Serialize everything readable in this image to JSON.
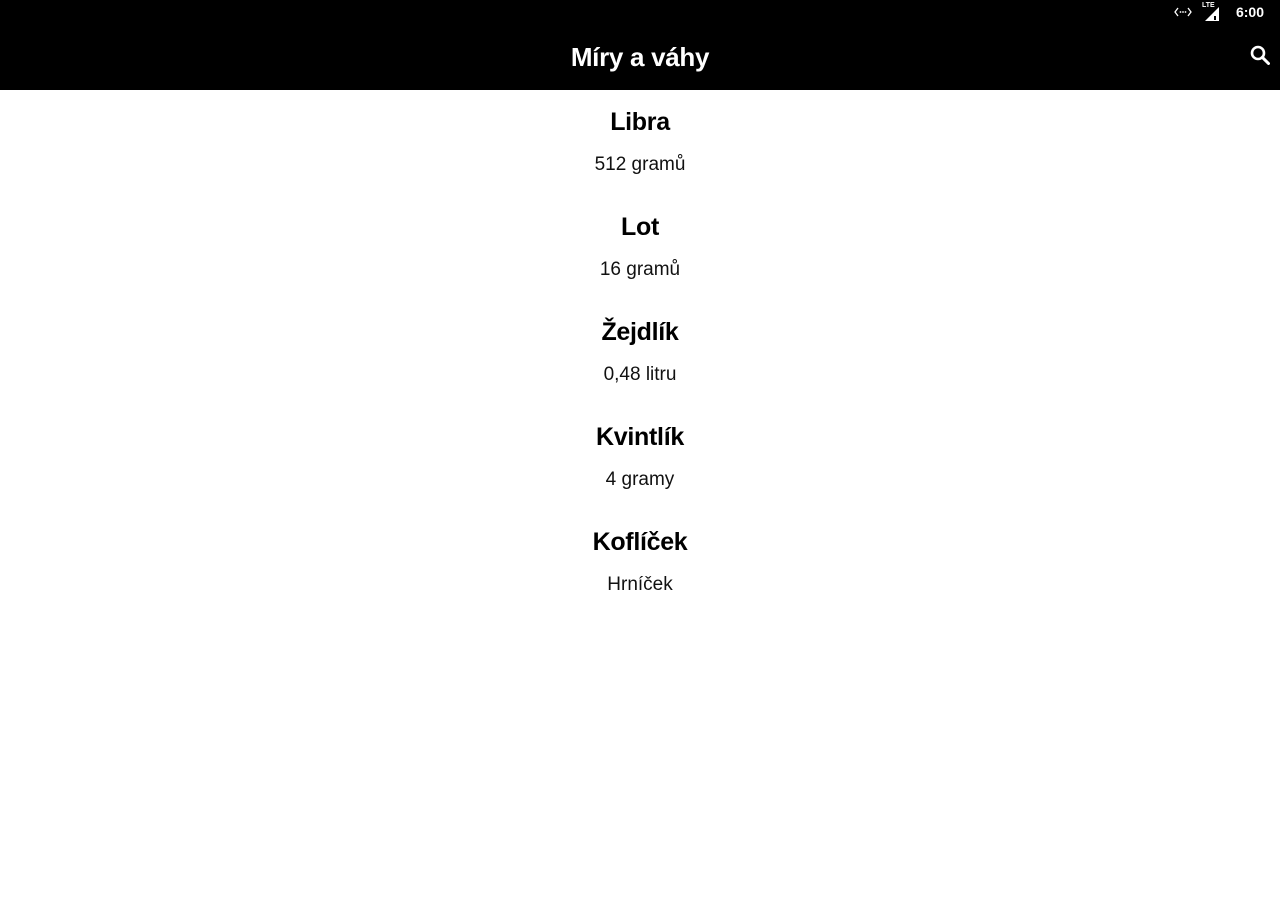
{
  "status_bar": {
    "time": "6:00",
    "network_label": "LTE",
    "icons": [
      "data-activity-icon",
      "lte-signal-icon"
    ]
  },
  "app_bar": {
    "title": "Míry a váhy",
    "search_icon": "search-icon"
  },
  "items": [
    {
      "title": "Libra",
      "value": "512 gramů"
    },
    {
      "title": "Lot",
      "value": "16 gramů"
    },
    {
      "title": "Žejdlík",
      "value": "0,48 litru"
    },
    {
      "title": "Kvintlík",
      "value": "4 gramy"
    },
    {
      "title": "Koflíček",
      "value": "Hrníček"
    }
  ]
}
